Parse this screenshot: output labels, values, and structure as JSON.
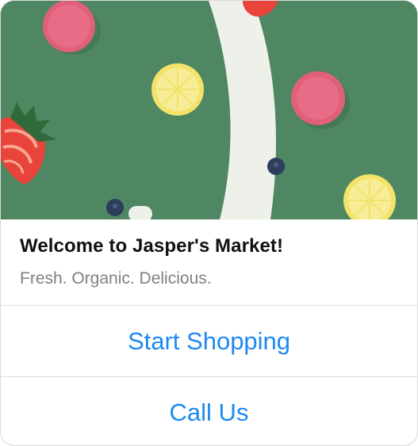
{
  "card": {
    "hero_image": "fruit-macaron-flatlay",
    "title": "Welcome to Jasper's Market!",
    "subtitle": "Fresh. Organic. Delicious."
  },
  "actions": [
    {
      "label": "Start Shopping"
    },
    {
      "label": "Call Us"
    }
  ],
  "colors": {
    "background_green": "#4e8761",
    "link_blue": "#1e88f0",
    "title_text": "#111111",
    "subtitle_text": "#808080"
  }
}
